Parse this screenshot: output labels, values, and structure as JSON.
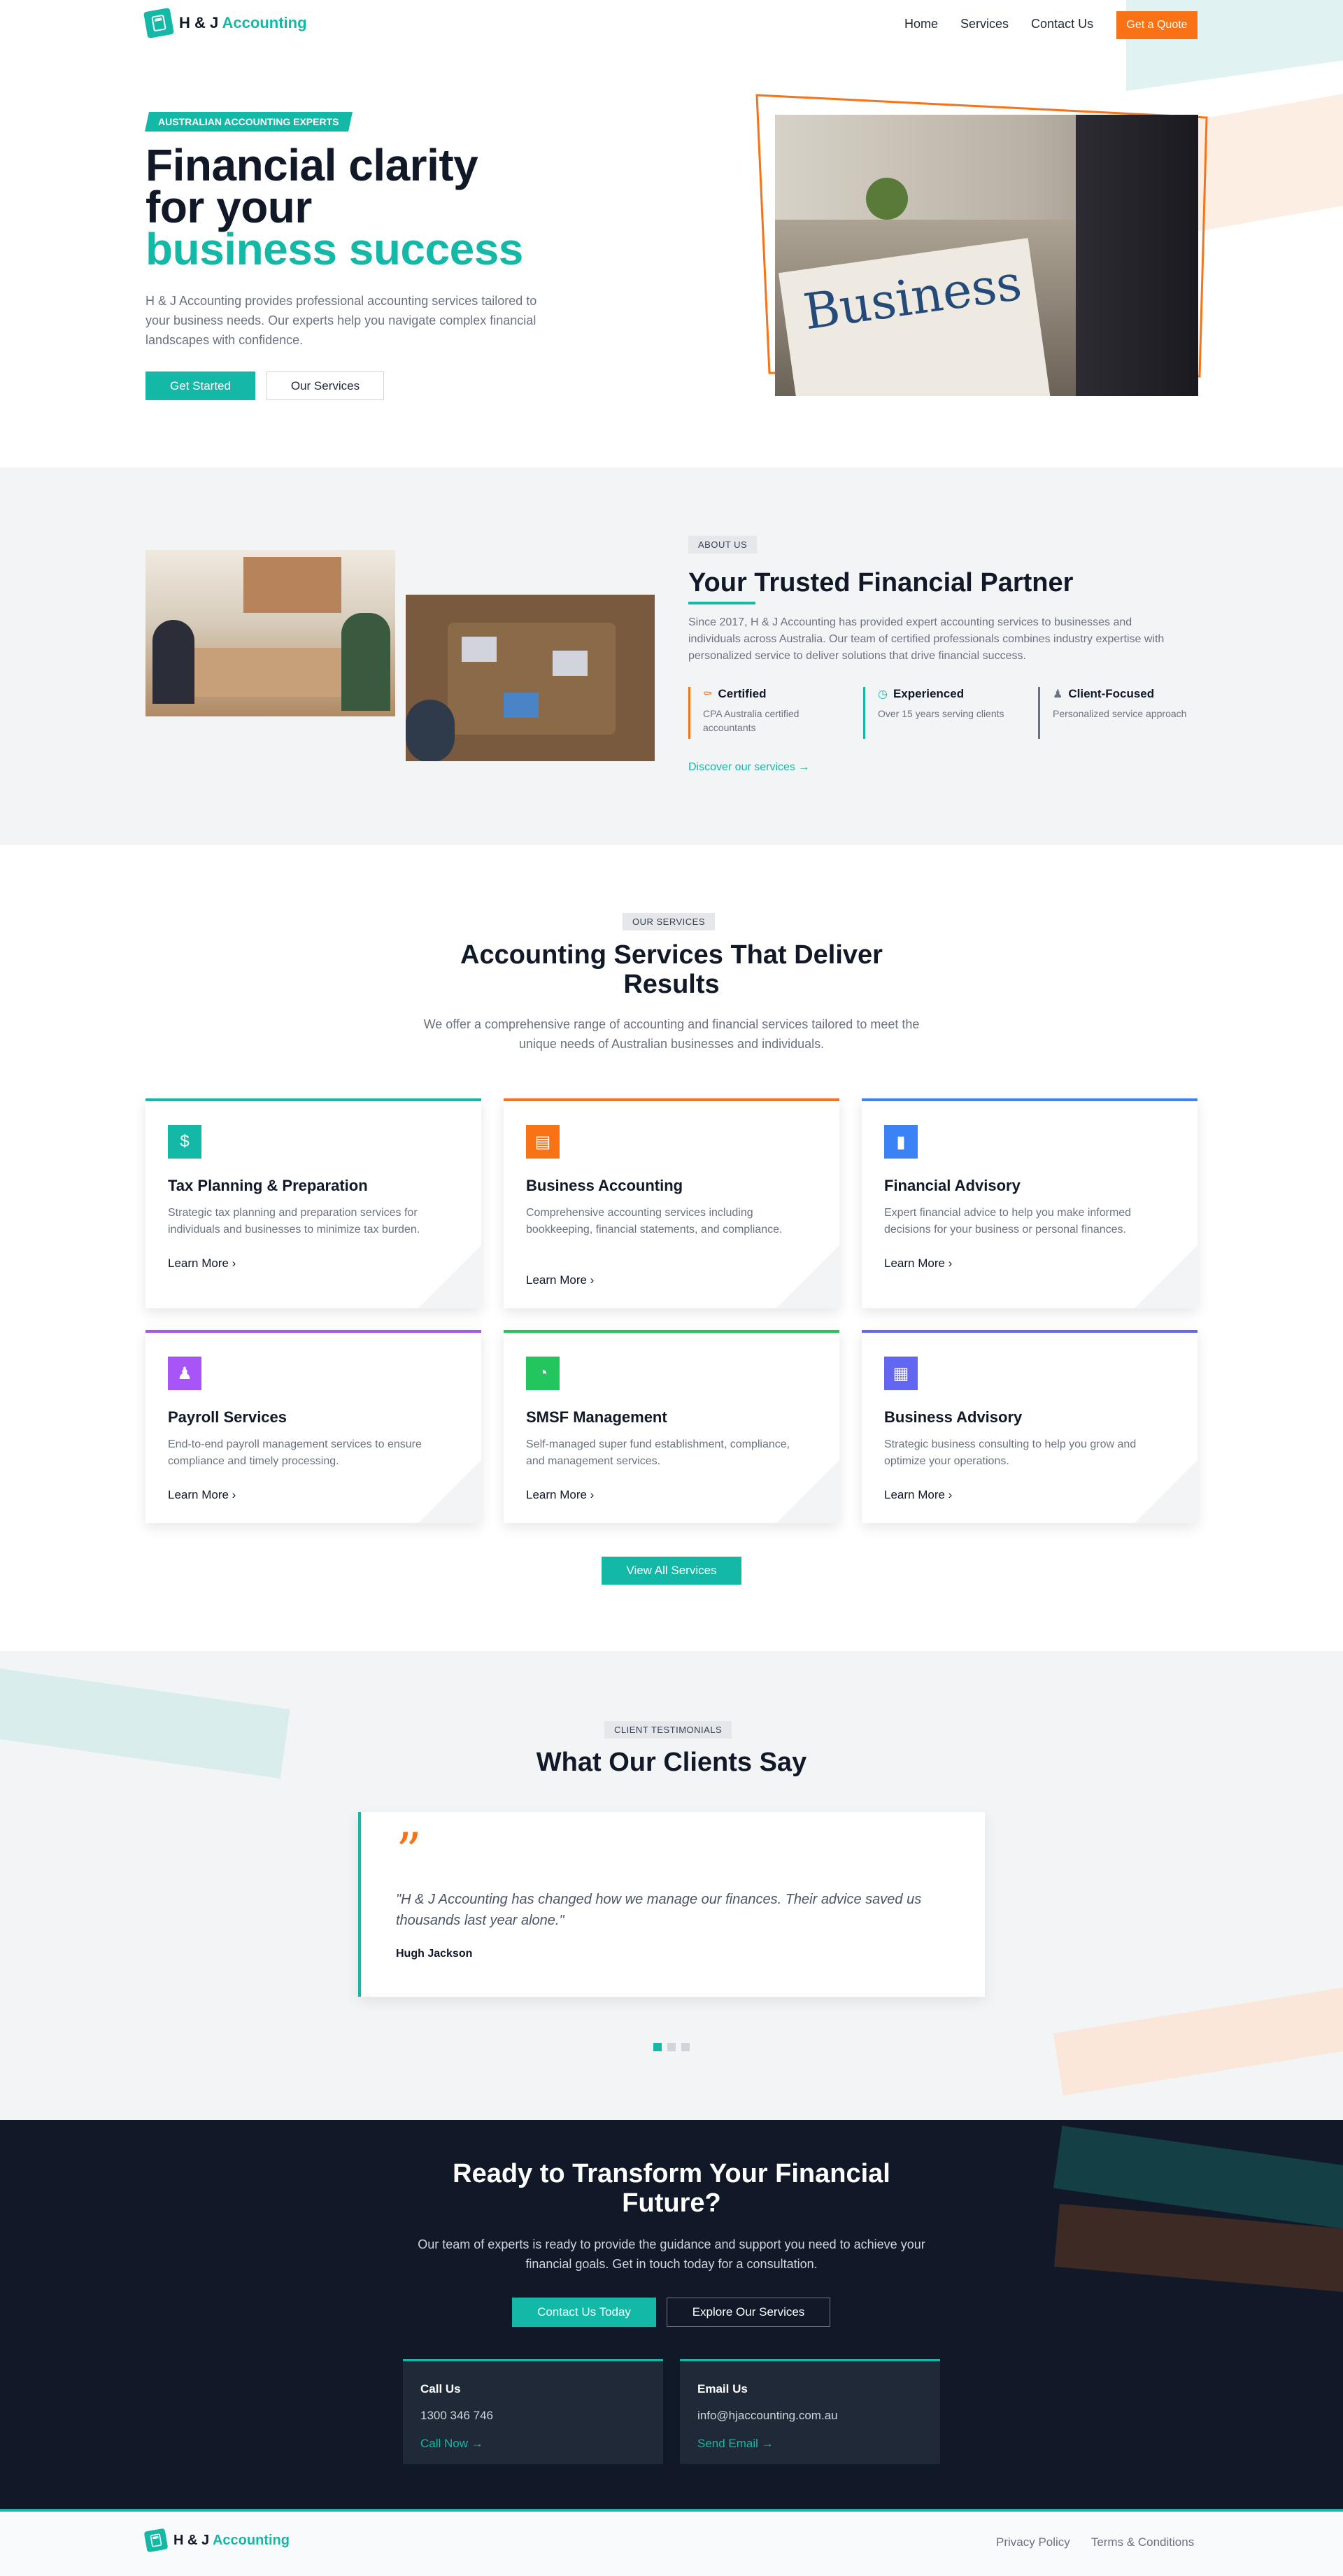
{
  "brand": {
    "name_part1": "H & J",
    "name_part2": "Accounting"
  },
  "nav": {
    "home": "Home",
    "services": "Services",
    "contact": "Contact Us",
    "quote": "Get a Quote"
  },
  "hero": {
    "badge": "AUSTRALIAN ACCOUNTING EXPERTS",
    "title_line1": "Financial clarity",
    "title_line2": "for your",
    "title_line3": "business success",
    "description": "H & J Accounting provides professional accounting services tailored to your business needs. Our experts help you navigate complex financial landscapes with confidence.",
    "cta_primary": "Get Started",
    "cta_secondary": "Our Services",
    "image_text": "Business"
  },
  "about": {
    "badge": "ABOUT US",
    "title": "Your Trusted Financial Partner",
    "description": "Since 2017, H & J Accounting has provided expert accounting services to businesses and individuals across Australia. Our team of certified professionals combines industry expertise with personalized service to deliver solutions that drive financial success.",
    "features": [
      {
        "title": "Certified",
        "desc": "CPA Australia certified accountants",
        "icon": "award-icon",
        "color": "#f97316"
      },
      {
        "title": "Experienced",
        "desc": "Over 15 years serving clients",
        "icon": "clock-icon",
        "color": "#14b8a6"
      },
      {
        "title": "Client-Focused",
        "desc": "Personalized service approach",
        "icon": "users-icon",
        "color": "#6b7280"
      }
    ],
    "link": "Discover our services"
  },
  "services": {
    "badge": "OUR SERVICES",
    "title_line1": "Accounting Services That Deliver",
    "title_line2": "Results",
    "description": "We offer a comprehensive range of accounting and financial services tailored to meet the unique needs of Australian businesses and individuals.",
    "learn_more": "Learn More",
    "cards": [
      {
        "title": "Tax Planning & Preparation",
        "desc": "Strategic tax planning and preparation services for individuals and businesses to minimize tax burden.",
        "color": "#14b8a6",
        "icon": "dollar-icon"
      },
      {
        "title": "Business Accounting",
        "desc": "Comprehensive accounting services including bookkeeping, financial statements, and compliance.",
        "color": "#f97316",
        "icon": "document-icon"
      },
      {
        "title": "Financial Advisory",
        "desc": "Expert financial advice to help you make informed decisions for your business or personal finances.",
        "color": "#3b82f6",
        "icon": "bar-chart-icon"
      },
      {
        "title": "Payroll Services",
        "desc": "End-to-end payroll management services to ensure compliance and timely processing.",
        "color": "#a855f7",
        "icon": "users-icon"
      },
      {
        "title": "SMSF Management",
        "desc": "Self-managed super fund establishment, compliance, and management services.",
        "color": "#22c55e",
        "icon": "pie-chart-icon"
      },
      {
        "title": "Business Advisory",
        "desc": "Strategic business consulting to help you grow and optimize your operations.",
        "color": "#6366f1",
        "icon": "building-icon"
      }
    ],
    "view_all": "View All Services"
  },
  "testimonials": {
    "badge": "CLIENT TESTIMONIALS",
    "title": "What Our Clients Say",
    "quote": "\"H & J Accounting has changed how we manage our finances. Their advice saved us thousands last year alone.\"",
    "author": "Hugh Jackson"
  },
  "cta": {
    "title_line1": "Ready to Transform Your Financial",
    "title_line2": "Future?",
    "description": "Our team of experts is ready to provide the guidance and support you need to achieve your financial goals. Get in touch today for a consultation.",
    "primary": "Contact Us Today",
    "secondary": "Explore Our Services",
    "call": {
      "label": "Call Us",
      "value": "1300 346 746",
      "link": "Call Now"
    },
    "email": {
      "label": "Email Us",
      "value": "info@hjaccounting.com.au",
      "link": "Send Email"
    }
  },
  "footer": {
    "privacy": "Privacy Policy",
    "terms": "Terms & Conditions"
  }
}
